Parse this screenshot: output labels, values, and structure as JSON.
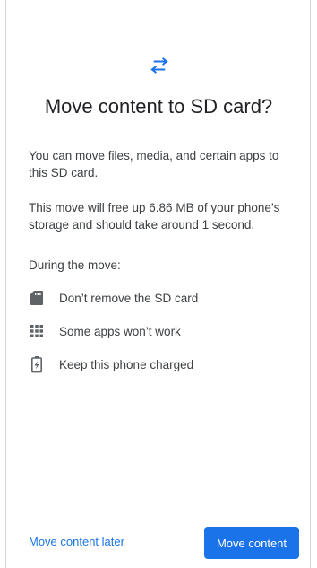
{
  "header": {
    "icon": "swap-arrows-icon",
    "title": "Move content to SD card?"
  },
  "body": {
    "paragraph_1": "You can move files, media, and certain apps to this SD card.",
    "paragraph_2": "This move will free up 6.86 MB of your phone’s storage and should take around 1 second.",
    "during_label": "During the move:"
  },
  "items": [
    {
      "icon": "sd-card-icon",
      "label": "Don’t remove the SD card"
    },
    {
      "icon": "apps-grid-icon",
      "label": "Some apps won’t work"
    },
    {
      "icon": "battery-charging-icon",
      "label": "Keep this phone charged"
    }
  ],
  "footer": {
    "secondary_label": "Move content later",
    "primary_label": "Move content"
  },
  "colors": {
    "accent": "#1a73e8",
    "text_primary": "#202124",
    "text_secondary": "#3c4043",
    "icon": "#5f6368"
  }
}
